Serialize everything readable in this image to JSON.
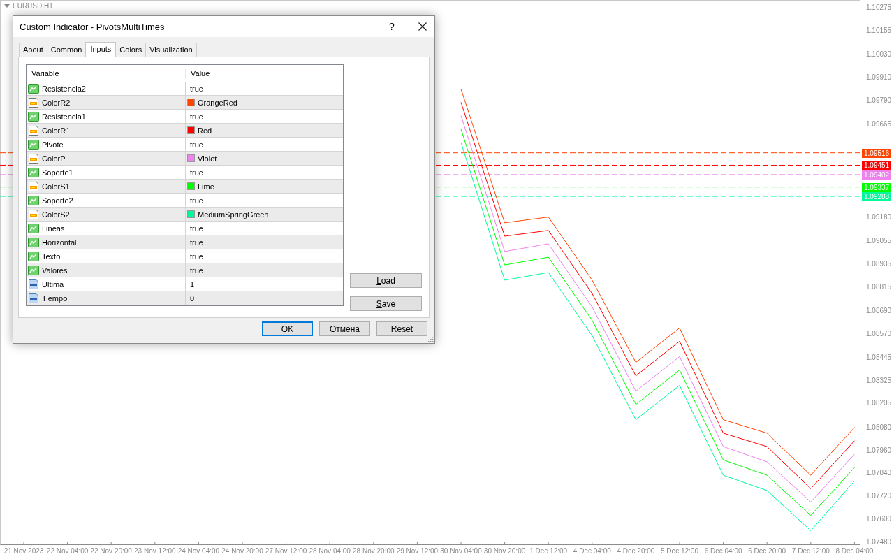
{
  "chart": {
    "symbol": "EURUSD,H1",
    "chart_data": {
      "type": "line",
      "categories": [
        "21 Nov 2023",
        "22 Nov 04:00",
        "22 Nov 20:00",
        "23 Nov 12:00",
        "24 Nov 04:00",
        "24 Nov 20:00",
        "27 Nov 12:00",
        "28 Nov 04:00",
        "28 Nov 20:00",
        "29 Nov 12:00",
        "30 Nov 04:00",
        "30 Nov 20:00",
        "1 Dec 12:00",
        "4 Dec 04:00",
        "4 Dec 20:00",
        "5 Dec 12:00",
        "6 Dec 04:00",
        "6 Dec 20:00",
        "7 Dec 12:00",
        "8 Dec 04:00"
      ],
      "series": [
        {
          "color": "#ff4500",
          "values": [
            null,
            null,
            null,
            null,
            null,
            null,
            null,
            null,
            null,
            null,
            1.0985,
            1.0915,
            1.0918,
            1.0885,
            1.0842,
            1.086,
            1.0812,
            1.0805,
            1.0783,
            1.0808
          ]
        },
        {
          "color": "#ff0000",
          "values": [
            null,
            null,
            null,
            null,
            null,
            null,
            null,
            null,
            null,
            null,
            1.0978,
            1.0908,
            1.0911,
            1.0878,
            1.0835,
            1.0853,
            1.0805,
            1.0798,
            1.0776,
            1.0801
          ]
        },
        {
          "color": "#ee82ee",
          "values": [
            null,
            null,
            null,
            null,
            null,
            null,
            null,
            null,
            null,
            null,
            1.0971,
            1.09,
            1.0904,
            1.0871,
            1.0827,
            1.0845,
            1.0798,
            1.079,
            1.0769,
            1.0794
          ]
        },
        {
          "color": "#00ff00",
          "values": [
            null,
            null,
            null,
            null,
            null,
            null,
            null,
            null,
            null,
            null,
            1.0964,
            1.0893,
            1.0897,
            1.0864,
            1.082,
            1.0838,
            1.0791,
            1.0783,
            1.0762,
            1.0787
          ]
        },
        {
          "color": "#00fa9a",
          "values": [
            null,
            null,
            null,
            null,
            null,
            null,
            null,
            null,
            null,
            null,
            1.0957,
            1.0885,
            1.0889,
            1.0856,
            1.0812,
            1.083,
            1.0783,
            1.0775,
            1.0754,
            1.078
          ]
        }
      ],
      "ylim": [
        1.07465,
        1.10315
      ],
      "yticks": [
        {
          "value": 1.10275,
          "label": "1.10275"
        },
        {
          "value": 1.10155,
          "label": "1.10155"
        },
        {
          "value": 1.1003,
          "label": "1.10030"
        },
        {
          "value": 1.0991,
          "label": "1.09910"
        },
        {
          "value": 1.0979,
          "label": "1.09790"
        },
        {
          "value": 1.09665,
          "label": "1.09665"
        },
        {
          "value": 1.0918,
          "label": "1.09180"
        },
        {
          "value": 1.09055,
          "label": "1.09055"
        },
        {
          "value": 1.08935,
          "label": "1.08935"
        },
        {
          "value": 1.08815,
          "label": "1.08815"
        },
        {
          "value": 1.0869,
          "label": "1.08690"
        },
        {
          "value": 1.0857,
          "label": "1.08570"
        },
        {
          "value": 1.08445,
          "label": "1.08445"
        },
        {
          "value": 1.08325,
          "label": "1.08325"
        },
        {
          "value": 1.08205,
          "label": "1.08205"
        },
        {
          "value": 1.0808,
          "label": "1.08080"
        },
        {
          "value": 1.0796,
          "label": "1.07960"
        },
        {
          "value": 1.0784,
          "label": "1.07840"
        },
        {
          "value": 1.0772,
          "label": "1.07720"
        },
        {
          "value": 1.076,
          "label": "1.07600"
        },
        {
          "value": 1.0748,
          "label": "1.07480"
        }
      ],
      "ref_lines": [
        {
          "axis": "y",
          "value": 1.09516,
          "label": "1.09516",
          "color": "#ff4500"
        },
        {
          "axis": "y",
          "value": 1.09451,
          "label": "1.09451",
          "color": "#ff0000"
        },
        {
          "axis": "y",
          "value": 1.09402,
          "label": "1.09402",
          "color": "#ee82ee"
        },
        {
          "axis": "y",
          "value": 1.09337,
          "label": "1.09337",
          "color": "#00ff00"
        },
        {
          "axis": "y",
          "value": 1.09288,
          "label": "1.09288",
          "color": "#00fa9a"
        }
      ]
    }
  },
  "dialog": {
    "title": "Custom Indicator - PivotsMultiTimes",
    "help": "?",
    "tabs": [
      {
        "label": "About",
        "selected": false
      },
      {
        "label": "Common",
        "selected": false
      },
      {
        "label": "Inputs",
        "selected": true
      },
      {
        "label": "Colors",
        "selected": false
      },
      {
        "label": "Visualization",
        "selected": false
      }
    ],
    "table": {
      "columns": [
        "Variable",
        "Value"
      ],
      "rows": [
        {
          "kind": "bool",
          "variable": "Resistencia2",
          "value": "true"
        },
        {
          "kind": "color",
          "variable": "ColorR2",
          "value": "OrangeRed",
          "color": "#ff4500"
        },
        {
          "kind": "bool",
          "variable": "Resistencia1",
          "value": "true"
        },
        {
          "kind": "color",
          "variable": "ColorR1",
          "value": "Red",
          "color": "#ff0000"
        },
        {
          "kind": "bool",
          "variable": "Pivote",
          "value": "true"
        },
        {
          "kind": "color",
          "variable": "ColorP",
          "value": "Violet",
          "color": "#ee82ee"
        },
        {
          "kind": "bool",
          "variable": "Soporte1",
          "value": "true"
        },
        {
          "kind": "color",
          "variable": "ColorS1",
          "value": "Lime",
          "color": "#00ff00"
        },
        {
          "kind": "bool",
          "variable": "Soporte2",
          "value": "true"
        },
        {
          "kind": "color",
          "variable": "ColorS2",
          "value": "MediumSpringGreen",
          "color": "#00fa9a"
        },
        {
          "kind": "bool",
          "variable": "Lineas",
          "value": "true"
        },
        {
          "kind": "bool",
          "variable": "Horizontal",
          "value": "true"
        },
        {
          "kind": "bool",
          "variable": "Texto",
          "value": "true"
        },
        {
          "kind": "bool",
          "variable": "Valores",
          "value": "true"
        },
        {
          "kind": "number",
          "variable": "Ultima",
          "value": "1"
        },
        {
          "kind": "number",
          "variable": "Tiempo",
          "value": "0"
        }
      ]
    },
    "side_buttons": [
      "Load",
      "Save"
    ],
    "buttons": [
      {
        "label": "OK",
        "default": true
      },
      {
        "label": "Отмена",
        "default": false
      },
      {
        "label": "Reset",
        "default": false
      }
    ]
  }
}
